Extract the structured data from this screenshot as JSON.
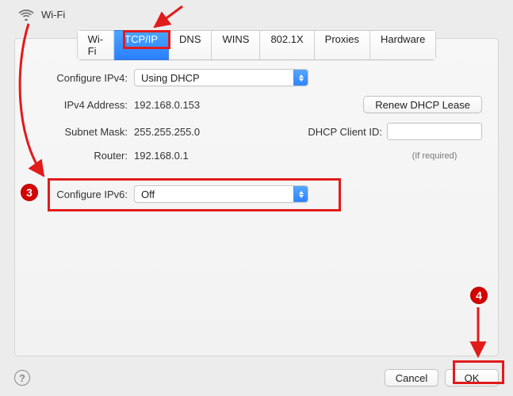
{
  "header": {
    "title": "Wi-Fi"
  },
  "tabs": {
    "items": [
      "Wi-Fi",
      "TCP/IP",
      "DNS",
      "WINS",
      "802.1X",
      "Proxies",
      "Hardware"
    ],
    "selected_index": 1
  },
  "form": {
    "ipv4": {
      "label": "Configure IPv4:",
      "value": "Using DHCP"
    },
    "ipv4_address": {
      "label": "IPv4 Address:",
      "value": "192.168.0.153"
    },
    "subnet_mask": {
      "label": "Subnet Mask:",
      "value": "255.255.255.0"
    },
    "router": {
      "label": "Router:",
      "value": "192.168.0.1"
    },
    "renew_label": "Renew DHCP Lease",
    "dhcp_client": {
      "label": "DHCP Client ID:",
      "value": "",
      "hint": "(If required)"
    },
    "ipv6": {
      "label": "Configure IPv6:",
      "value": "Off"
    }
  },
  "footer": {
    "cancel": "Cancel",
    "ok": "OK"
  },
  "annotations": {
    "marker3": "3",
    "marker4": "4"
  }
}
